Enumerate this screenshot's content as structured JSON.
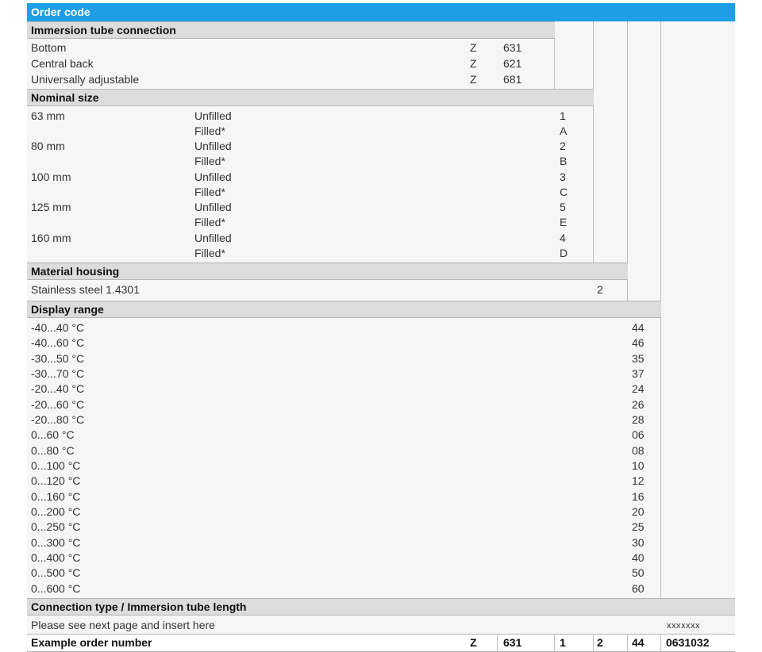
{
  "title": "Order code",
  "immersion": {
    "header": "Immersion tube connection",
    "rows": [
      {
        "label": "Bottom",
        "letter": "Z",
        "code": "631"
      },
      {
        "label": "Central back",
        "letter": "Z",
        "code": "621"
      },
      {
        "label": "Universally adjustable",
        "letter": "Z",
        "code": "681"
      }
    ]
  },
  "nominal": {
    "header": "Nominal size",
    "sizes": [
      "63 mm",
      "80 mm",
      "100 mm",
      "125 mm",
      "160 mm"
    ],
    "rows": [
      {
        "fill": "Unfilled",
        "code": "1"
      },
      {
        "fill": "Filled*",
        "code": "A"
      },
      {
        "fill": "Unfilled",
        "code": "2"
      },
      {
        "fill": "Filled*",
        "code": "B"
      },
      {
        "fill": "Unfilled",
        "code": "3"
      },
      {
        "fill": "Filled*",
        "code": "C"
      },
      {
        "fill": "Unfilled",
        "code": "5"
      },
      {
        "fill": "Filled*",
        "code": "E"
      },
      {
        "fill": "Unfilled",
        "code": "4"
      },
      {
        "fill": "Filled*",
        "code": "D"
      }
    ]
  },
  "material": {
    "header": "Material housing",
    "rows": [
      {
        "label": "Stainless steel 1.4301",
        "code": "2"
      }
    ]
  },
  "display": {
    "header": "Display range",
    "rows": [
      {
        "range": "-40...40 °C",
        "code": "44"
      },
      {
        "range": "-40...60 °C",
        "code": "46"
      },
      {
        "range": "-30...50 °C",
        "code": "35"
      },
      {
        "range": "-30...70 °C",
        "code": "37"
      },
      {
        "range": "-20...40 °C",
        "code": "24"
      },
      {
        "range": "-20...60 °C",
        "code": "26"
      },
      {
        "range": "-20...80 °C",
        "code": "28"
      },
      {
        "range": "0...60 °C",
        "code": "06"
      },
      {
        "range": "0...80 °C",
        "code": "08"
      },
      {
        "range": "0...100 °C",
        "code": "10"
      },
      {
        "range": "0...120 °C",
        "code": "12"
      },
      {
        "range": "0...160 °C",
        "code": "16"
      },
      {
        "range": "0...200 °C",
        "code": "20"
      },
      {
        "range": "0...250 °C",
        "code": "25"
      },
      {
        "range": "0...300 °C",
        "code": "30"
      },
      {
        "range": "0...400 °C",
        "code": "40"
      },
      {
        "range": "0...500 °C",
        "code": "50"
      },
      {
        "range": "0...600 °C",
        "code": "60"
      }
    ]
  },
  "connection": {
    "header": "Connection type / Immersion tube length",
    "note": "Please see next page and insert here",
    "code": "xxxxxxx"
  },
  "example": {
    "label": "Example order number",
    "letter": "Z",
    "connection": "631",
    "size": "1",
    "material": "2",
    "range": "44",
    "length": "0631032"
  },
  "colors": {
    "title_bar": "#1e9ee4",
    "header_bg": "#dcdcdc",
    "body_bg": "#f6f6f6"
  }
}
